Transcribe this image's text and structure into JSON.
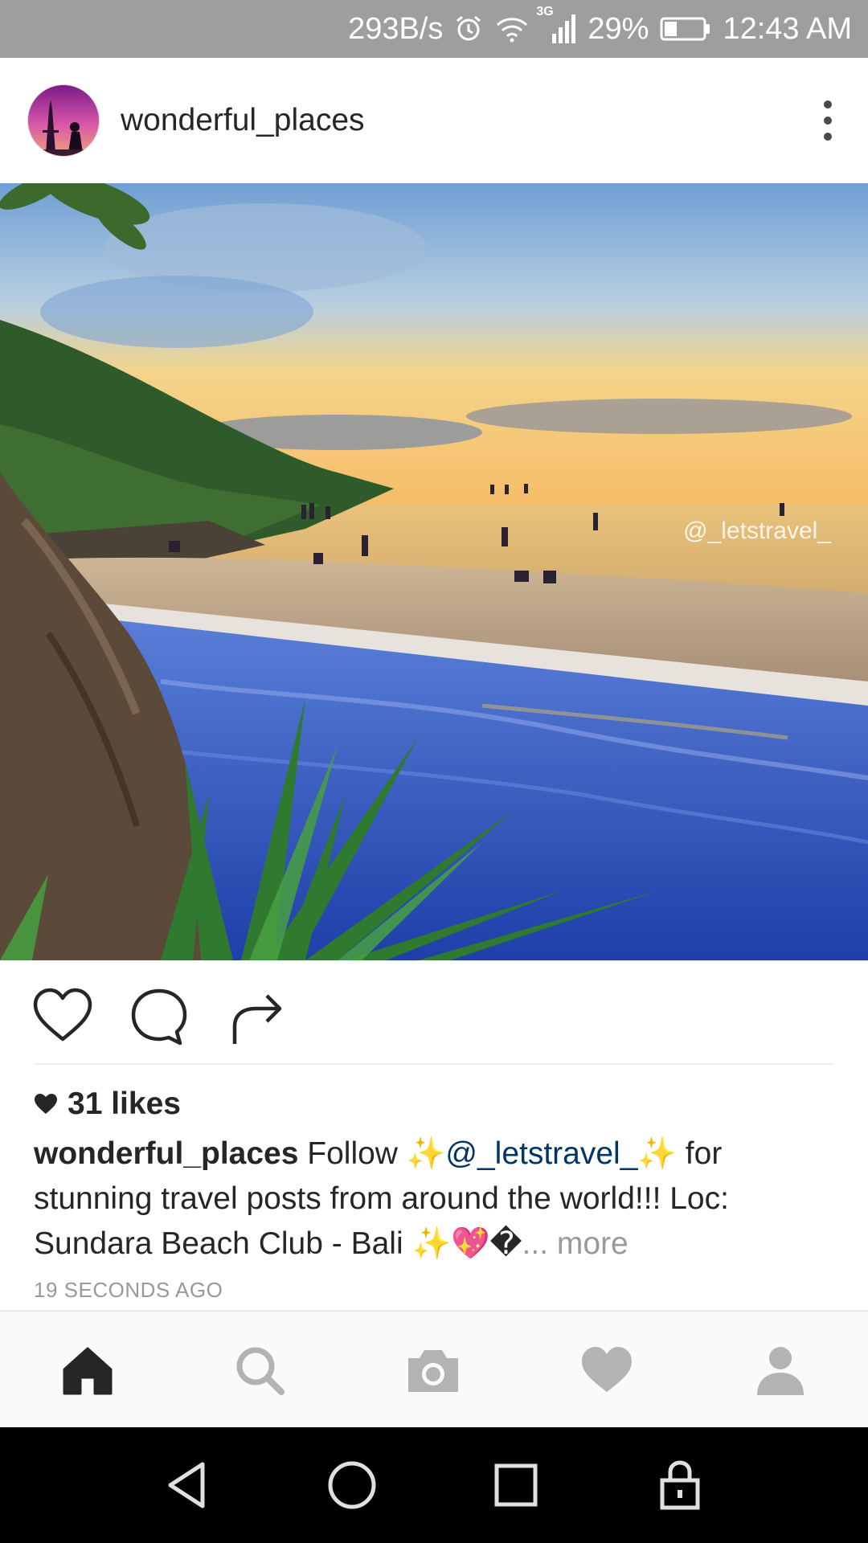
{
  "status_bar": {
    "net_speed": "293B/s",
    "network_type": "3G",
    "battery": "29%",
    "time": "12:43 AM",
    "icons": [
      "alarm-icon",
      "wifi-icon",
      "signal-icon",
      "battery-icon"
    ]
  },
  "post": {
    "username": "wonderful_places",
    "photo_watermark": "@_letstravel_",
    "likes": "31 likes",
    "caption": {
      "user": "wonderful_places",
      "text_1": " Follow ",
      "sparkle_1": "✨",
      "mention": "@_letstravel_",
      "sparkle_2": "✨",
      "text_2": " for stunning travel posts from around the world!!! Loc: Sundara Beach Club - Bali ",
      "emoji_tail": "✨💖�",
      "more": "... more"
    },
    "timestamp": "19 SECONDS AGO"
  },
  "actions": [
    "heart-outline-icon",
    "comment-icon",
    "share-icon"
  ],
  "bottom_nav": [
    "home-icon",
    "search-icon",
    "camera-icon",
    "heart-icon",
    "profile-icon"
  ],
  "system_nav": [
    "back-icon",
    "home-circle-icon",
    "recents-icon",
    "lock-icon"
  ],
  "colors": {
    "status_bar": "#9e9e9e",
    "mention": "#003569",
    "muted": "#999999",
    "text": "#262626"
  }
}
